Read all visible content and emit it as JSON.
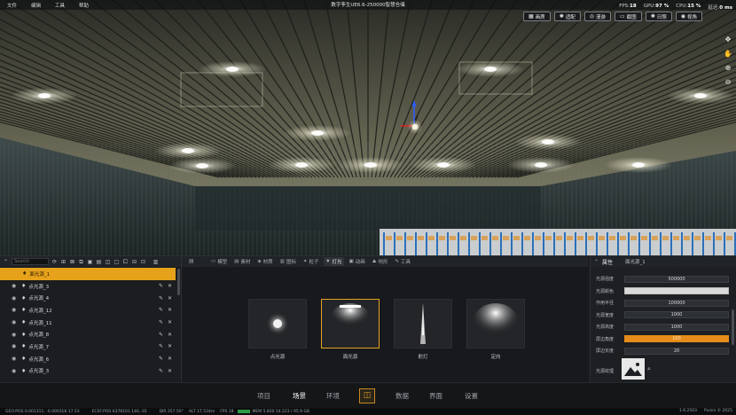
{
  "menu": [
    "文件",
    "编辑",
    "工具",
    "帮助"
  ],
  "app_title": "数字孪生UE6.6-250000智慧仓储",
  "stats": [
    {
      "label": "FPS:",
      "value": "18"
    },
    {
      "label": "GPU:",
      "value": "97 %"
    },
    {
      "label": "CPU:",
      "value": "15 %"
    },
    {
      "label": "延迟:",
      "value": "0 ms"
    }
  ],
  "render_modes": [
    {
      "icon": "grid-icon",
      "label": "画质"
    },
    {
      "icon": "sun-icon",
      "label": "适配"
    },
    {
      "icon": "glasses-icon",
      "label": "漫游"
    },
    {
      "icon": "monitor-icon",
      "label": "截图"
    },
    {
      "icon": "sun-icon",
      "label": "日照"
    },
    {
      "icon": "eye-icon",
      "label": "视角"
    }
  ],
  "outliner": {
    "search_placeholder": "Search",
    "items": [
      "面光源_1",
      "点光源_3",
      "点光源_4",
      "点光源_12",
      "点光源_11",
      "点光源_8",
      "点光源_7",
      "点光源_6",
      "点光源_3"
    ]
  },
  "asset_tabs": [
    {
      "label": "模型",
      "active": false
    },
    {
      "label": "素材",
      "active": false
    },
    {
      "label": "材质",
      "active": false
    },
    {
      "label": "图标",
      "active": false
    },
    {
      "label": "粒子",
      "active": false
    },
    {
      "label": "灯光",
      "active": true
    },
    {
      "label": "动画",
      "active": false
    },
    {
      "label": "地形",
      "active": false
    },
    {
      "label": "工具",
      "active": false
    }
  ],
  "asset_cards": [
    {
      "label": "点光源",
      "kind": "point",
      "selected": false
    },
    {
      "label": "面光源",
      "kind": "rect",
      "selected": true
    },
    {
      "label": "射灯",
      "kind": "spot",
      "selected": false
    },
    {
      "label": "定向",
      "kind": "directional",
      "selected": false
    }
  ],
  "properties": {
    "title": "属性",
    "object_name": "面光源_1",
    "rows": [
      {
        "label": "光源强度",
        "value": "500000",
        "style": "dark"
      },
      {
        "label": "光源颜色",
        "value": "",
        "style": "white"
      },
      {
        "label": "作用半径",
        "value": "100000",
        "style": "dark"
      },
      {
        "label": "光源宽度",
        "value": "1000",
        "style": "dark"
      },
      {
        "label": "光源高度",
        "value": "1000",
        "style": "dark"
      },
      {
        "label": "屏边角度",
        "value": "100",
        "style": "orange"
      },
      {
        "label": "屏边长度",
        "value": "20",
        "style": "dark"
      }
    ],
    "texture_label": "光源纹理"
  },
  "bottom_nav": [
    {
      "label": "项目",
      "active": false
    },
    {
      "label": "场景",
      "active": true
    },
    {
      "label": "环境",
      "active": false
    },
    {
      "label": "数据",
      "active": false
    },
    {
      "label": "界面",
      "active": false
    },
    {
      "label": "设置",
      "active": false
    }
  ],
  "statusbar": {
    "geo_pos": "GEO:POS 0.001311, -0.000318 17.53",
    "ecef_pos": "ECEF:POS 6378101.146,-35",
    "dir": "DIR 357.50°",
    "alt": "ALT 17.534m",
    "fps": "FPS 18",
    "mem": "MEM 5.820 14.223 / 95.9 GB",
    "version": "1.6.2503",
    "credit": "Pusini © 2025"
  }
}
